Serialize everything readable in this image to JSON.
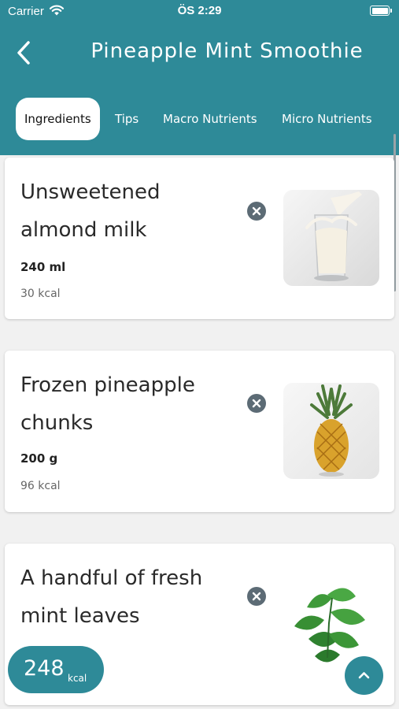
{
  "status_bar": {
    "carrier": "Carrier",
    "time": "ÖS 2:29"
  },
  "header": {
    "title": "Pineapple Mint Smoothie"
  },
  "tabs": [
    {
      "label": "Ingredients",
      "active": true
    },
    {
      "label": "Tips",
      "active": false
    },
    {
      "label": "Macro Nutrients",
      "active": false
    },
    {
      "label": "Micro Nutrients",
      "active": false
    }
  ],
  "ingredients": [
    {
      "name": "Unsweetened almond milk",
      "quantity": "240 ml",
      "kcal": "30 kcal",
      "image_icon": "almond-milk-image"
    },
    {
      "name": "Frozen pineapple chunks",
      "quantity": "200 g",
      "kcal": "96 kcal",
      "image_icon": "pineapple-image"
    },
    {
      "name": "A handful of fresh mint leaves",
      "quantity": "",
      "kcal": "",
      "image_icon": "mint-leaves-image"
    }
  ],
  "total": {
    "value": "248",
    "unit": "kcal"
  },
  "colors": {
    "accent": "#2e8a98",
    "remove": "#5c6b75"
  }
}
